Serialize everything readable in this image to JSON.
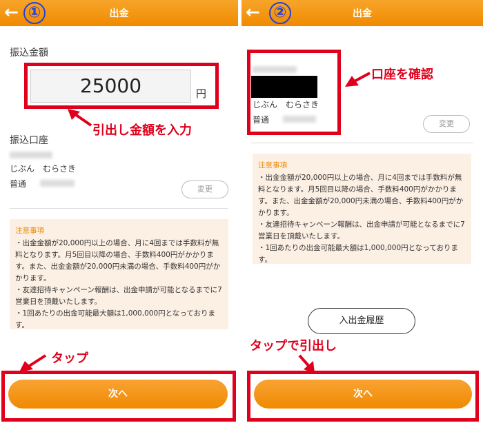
{
  "screens": [
    {
      "step_badge": "①",
      "header_title": "出金",
      "amount_section_label": "振込金額",
      "amount_value": "25000",
      "currency_unit": "円",
      "account_section_label": "振込口座",
      "bank_name": "じぶん　むらさき",
      "account_type": "普通",
      "change_button_label": "変更",
      "notice": {
        "title": "注意事項",
        "items": [
          "・出金金額が20,000円以上の場合、月に4回までは手数料が無料となります。月5回目以降の場合、手数料400円がかかります。また、出金金額が20,000円未満の場合、手数料400円がかかります。",
          "・友達招待キャンペーン報酬は、出金申請が可能となるまでに7営業日を頂戴いたします。",
          "・1回あたりの出金可能最大額は1,000,000円となっております。"
        ]
      },
      "next_button_label": "次へ",
      "annotations": {
        "amount_note": "引出し金額を入力",
        "tap_note": "タップ"
      }
    },
    {
      "step_badge": "②",
      "header_title": "出金",
      "bank_name": "じぶん　むらさき",
      "account_type": "普通",
      "change_button_label": "変更",
      "notice": {
        "title": "注意事項",
        "items": [
          "・出金金額が20,000円以上の場合、月に4回までは手数料が無料となります。月5回目以降の場合、手数料400円がかかります。また、出金金額が20,000円未満の場合、手数料400円がかかります。",
          "・友達招待キャンペーン報酬は、出金申請が可能となるまでに7営業日を頂戴いたします。",
          "・1回あたりの出金可能最大額は1,000,000円となっております。"
        ]
      },
      "history_button_label": "入出金履歴",
      "next_button_label": "次へ",
      "annotations": {
        "account_note": "口座を確認",
        "tap_note": "タップで引出し"
      }
    }
  ],
  "colors": {
    "header_orange": "#f08a00",
    "annotation_red": "#e0001b",
    "badge_blue": "#2540d8",
    "notice_bg": "#fcefe3"
  }
}
